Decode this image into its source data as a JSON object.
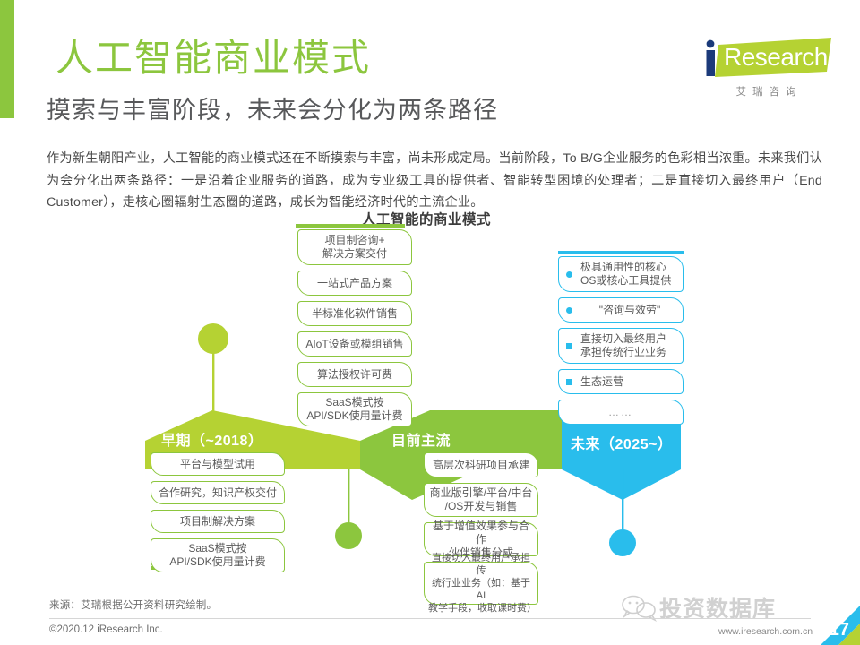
{
  "header": {
    "title_main": "人工智能商业模式",
    "title_sub": "摸索与丰富阶段，未来会分化为两条路径",
    "intro": "作为新生朝阳产业，人工智能的商业模式还在不断摸索与丰富，尚未形成定局。当前阶段，To B/G企业服务的色彩相当浓重。未来我们认为会分化出两条路径：一是沿着企业服务的道路，成为专业级工具的提供者、智能转型困境的处理者；二是直接切入最终用户（End Customer），走核心圈辐射生态圈的道路，成长为智能经济时代的主流企业。",
    "logo_text": "Research",
    "logo_i": "i",
    "logo_tagline": "艾瑞咨询"
  },
  "diagram": {
    "title": "人工智能的商业模式",
    "colors": {
      "light_green": "#b5d233",
      "green": "#8cc63e",
      "cyan": "#29bdec",
      "box_text": "#5b5b5b"
    },
    "banners": [
      {
        "label": "早期（~2018）",
        "color": "#b5d233"
      },
      {
        "label": "目前主流",
        "color": "#8cc63e"
      },
      {
        "label": "未来（2025~）",
        "color": "#29bdec"
      }
    ],
    "early_top_boxes": [],
    "mainstream_top_boxes": [
      {
        "text": "项目制咨询+\n解决方案交付",
        "lines": [
          "项目制咨询+",
          "解决方案交付"
        ]
      },
      {
        "text": "一站式产品方案",
        "lines": [
          "一站式产品方案"
        ]
      },
      {
        "text": "半标准化软件销售",
        "lines": [
          "半标准化软件销售"
        ]
      },
      {
        "text": "AIoT设备或模组销售",
        "lines": [
          "AIoT设备或模组销售"
        ]
      },
      {
        "text": "算法授权许可费",
        "lines": [
          "算法授权许可费"
        ]
      },
      {
        "text": "SaaS模式按\nAPI/SDK使用量计费",
        "lines": [
          "SaaS模式按",
          "API/SDK使用量计费"
        ]
      }
    ],
    "future_top_boxes": [
      {
        "marker": "dot",
        "lines": [
          "极具通用性的核心",
          "OS或核心工具提供"
        ]
      },
      {
        "marker": "dot",
        "lines": [
          "\"咨询与效劳\""
        ]
      },
      {
        "marker": "square",
        "lines": [
          "直接切入最终用户",
          "承担传统行业业务"
        ]
      },
      {
        "marker": "square",
        "lines": [
          "生态运营"
        ]
      },
      {
        "marker": "none",
        "lines": [
          "……"
        ]
      }
    ],
    "early_bottom_boxes": [
      {
        "lines": [
          "平台与模型试用"
        ]
      },
      {
        "lines": [
          "合作研究，知识产权交付"
        ]
      },
      {
        "lines": [
          "项目制解决方案"
        ]
      },
      {
        "lines": [
          "SaaS模式按",
          "API/SDK使用量计费"
        ]
      }
    ],
    "mainstream_bottom_boxes": [
      {
        "lines": [
          "高层次科研项目承建"
        ]
      },
      {
        "lines": [
          "商业版引擎/平台/中台",
          "/OS开发与销售"
        ]
      },
      {
        "lines": [
          "基于增值效果参与合作",
          "伙伴销售分成"
        ]
      },
      {
        "lines": [
          "直接切入最终用户承担传",
          "统行业业务（如：基于AI",
          "教学手段，收取课时费）"
        ]
      }
    ]
  },
  "footer": {
    "source": "来源：艾瑞根据公开资料研究绘制。",
    "copyright": "©2020.12 iResearch Inc.",
    "url": "www.iresearch.com.cn",
    "page": "17",
    "watermark": "投资数据库"
  }
}
